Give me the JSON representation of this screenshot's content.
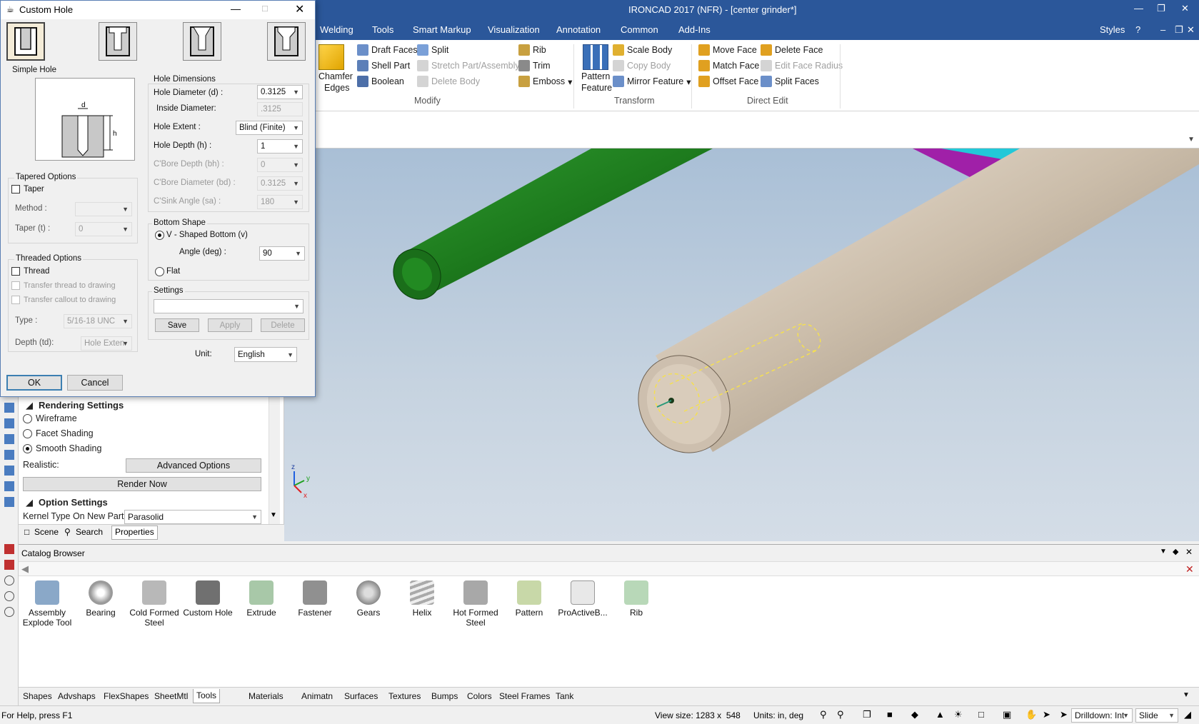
{
  "app": {
    "title": "IRONCAD 2017 (NFR) - [center grinder*]",
    "styles_label": "Styles"
  },
  "ribbon": {
    "tabs": [
      "Welding",
      "Tools",
      "Smart Markup",
      "Visualization",
      "Annotation",
      "Common",
      "Add-Ins"
    ],
    "modify": {
      "chamfer_line1": "Chamfer",
      "chamfer_line2": "Edges",
      "draft_faces": "Draft Faces",
      "shell_part": "Shell Part",
      "boolean": "Boolean",
      "split": "Split",
      "stretch": "Stretch Part/Assembly",
      "delete_body": "Delete Body",
      "rib": "Rib",
      "trim": "Trim",
      "emboss": "Emboss",
      "group_label": "Modify"
    },
    "transform": {
      "pattern_line1": "Pattern",
      "pattern_line2": "Feature",
      "scale_body": "Scale Body",
      "copy_body": "Copy Body",
      "mirror_feature": "Mirror Feature",
      "group_label": "Transform"
    },
    "direct_edit": {
      "move_face": "Move Face",
      "match_face": "Match Face",
      "offset_face": "Offset Face",
      "delete_face": "Delete Face",
      "edit_face_radius": "Edit Face Radius",
      "split_faces": "Split Faces",
      "group_label": "Direct Edit"
    }
  },
  "dialog": {
    "title": "Custom Hole",
    "hole_type_label": "Simple Hole",
    "tapered": {
      "title": "Tapered Options",
      "taper_label": "Taper",
      "method_label": "Method :",
      "method_value": "",
      "taper_t_label": "Taper (t) :",
      "taper_t_value": "0"
    },
    "threaded": {
      "title": "Threaded Options",
      "thread_label": "Thread",
      "transfer_thread": "Transfer thread to drawing",
      "transfer_callout": "Transfer callout to drawing",
      "type_label": "Type :",
      "type_value": "5/16-18 UNC",
      "depth_label": "Depth (td):",
      "depth_value": "Hole Exten"
    },
    "dimensions": {
      "title": "Hole Dimensions",
      "hole_diameter_label": "Hole Diameter (d) :",
      "hole_diameter_value": "0.3125",
      "inside_diameter_label": "Inside Diameter:",
      "inside_diameter_value": ".3125",
      "hole_extent_label": "Hole Extent :",
      "hole_extent_value": "Blind (Finite)",
      "hole_depth_label": "Hole Depth (h) :",
      "hole_depth_value": "1",
      "cbore_depth_label": "C'Bore Depth (bh) :",
      "cbore_depth_value": "0",
      "cbore_diameter_label": "C'Bore Diameter (bd) :",
      "cbore_diameter_value": "0.3125",
      "csink_angle_label": "C'Sink Angle (sa) :",
      "csink_angle_value": "180"
    },
    "bottom": {
      "title": "Bottom Shape",
      "vshaped_label": "V - Shaped Bottom (v)",
      "angle_label": "Angle (deg) :",
      "angle_value": "90",
      "flat_label": "Flat"
    },
    "settings": {
      "title": "Settings",
      "value": "",
      "save": "Save",
      "apply": "Apply",
      "delete": "Delete"
    },
    "unit_label": "Unit:",
    "unit_value": "English",
    "ok": "OK",
    "cancel": "Cancel"
  },
  "properties": {
    "rendering_title": "Rendering Settings",
    "wireframe": "Wireframe",
    "facet": "Facet Shading",
    "smooth": "Smooth Shading",
    "realistic_label": "Realistic:",
    "advanced_options": "Advanced Options",
    "render_now": "Render Now",
    "option_title": "Option Settings",
    "kernel_label": "Kernel Type On New Part",
    "kernel_value": "Parasolid",
    "tabs": [
      "Scene",
      "Search",
      "Properties"
    ]
  },
  "catalog": {
    "title": "Catalog Browser",
    "items": [
      [
        "Assembly",
        "Explode Tool"
      ],
      [
        "Bearing",
        ""
      ],
      [
        "Cold Formed",
        "Steel"
      ],
      [
        "Custom Hole",
        ""
      ],
      [
        "Extrude",
        ""
      ],
      [
        "Fastener",
        ""
      ],
      [
        "Gears",
        ""
      ],
      [
        "Helix",
        ""
      ],
      [
        "Hot Formed",
        "Steel"
      ],
      [
        "Pattern",
        ""
      ],
      [
        "ProActiveB...",
        ""
      ],
      [
        "Rib",
        ""
      ]
    ],
    "library_tabs": [
      "Shapes",
      "Advshaps",
      "FlexShapes",
      "SheetMtl",
      "Tools",
      "Materials",
      "Animatn",
      "Surfaces",
      "Textures",
      "Bumps",
      "Colors",
      "Steel Frames",
      "Tank"
    ],
    "active_tab": "Tools"
  },
  "status": {
    "help": "For Help, press F1",
    "view_size": "View size: 1283 x  548",
    "units": "Units: in, deg",
    "drilldown": "Drilldown: Int",
    "slide": "Slide"
  },
  "axis": {
    "z": "z",
    "y": "y",
    "x": "x"
  },
  "colors": {
    "titlebar": "#2b579a",
    "green_rod": "#1f7a1f",
    "tan_rod": "#c9bba8"
  }
}
